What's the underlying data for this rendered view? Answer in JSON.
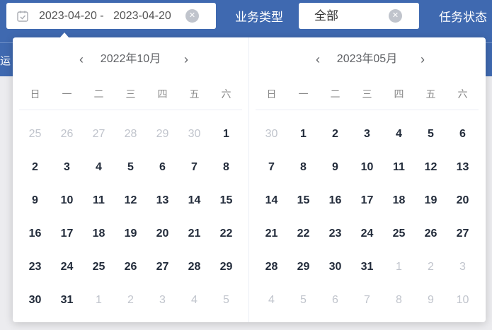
{
  "filters": {
    "date_range": "2023-04-20 -   2023-04-20",
    "business_type_label": "业务类型",
    "business_type_value": "全部",
    "task_status_label": "任务状态",
    "underlying_tab": "运"
  },
  "icons": {
    "calendar": "calendar-icon",
    "clear": "clear-icon",
    "prev": "chevron-left-icon",
    "next": "chevron-right-icon"
  },
  "colors": {
    "header": "#3f69b0",
    "muted_day": "#c0c4cc",
    "day": "#222b3a"
  },
  "weekdays": [
    "日",
    "一",
    "二",
    "三",
    "四",
    "五",
    "六"
  ],
  "calendar": {
    "left": {
      "title": "2022年10月",
      "days": [
        {
          "d": "25",
          "m": true
        },
        {
          "d": "26",
          "m": true
        },
        {
          "d": "27",
          "m": true
        },
        {
          "d": "28",
          "m": true
        },
        {
          "d": "29",
          "m": true
        },
        {
          "d": "30",
          "m": true
        },
        {
          "d": "1",
          "m": false
        },
        {
          "d": "2",
          "m": false
        },
        {
          "d": "3",
          "m": false
        },
        {
          "d": "4",
          "m": false
        },
        {
          "d": "5",
          "m": false
        },
        {
          "d": "6",
          "m": false
        },
        {
          "d": "7",
          "m": false
        },
        {
          "d": "8",
          "m": false
        },
        {
          "d": "9",
          "m": false
        },
        {
          "d": "10",
          "m": false
        },
        {
          "d": "11",
          "m": false
        },
        {
          "d": "12",
          "m": false
        },
        {
          "d": "13",
          "m": false
        },
        {
          "d": "14",
          "m": false
        },
        {
          "d": "15",
          "m": false
        },
        {
          "d": "16",
          "m": false
        },
        {
          "d": "17",
          "m": false
        },
        {
          "d": "18",
          "m": false
        },
        {
          "d": "19",
          "m": false
        },
        {
          "d": "20",
          "m": false
        },
        {
          "d": "21",
          "m": false
        },
        {
          "d": "22",
          "m": false
        },
        {
          "d": "23",
          "m": false
        },
        {
          "d": "24",
          "m": false
        },
        {
          "d": "25",
          "m": false
        },
        {
          "d": "26",
          "m": false
        },
        {
          "d": "27",
          "m": false
        },
        {
          "d": "28",
          "m": false
        },
        {
          "d": "29",
          "m": false
        },
        {
          "d": "30",
          "m": false
        },
        {
          "d": "31",
          "m": false
        },
        {
          "d": "1",
          "m": true
        },
        {
          "d": "2",
          "m": true
        },
        {
          "d": "3",
          "m": true
        },
        {
          "d": "4",
          "m": true
        },
        {
          "d": "5",
          "m": true
        }
      ]
    },
    "right": {
      "title": "2023年05月",
      "days": [
        {
          "d": "30",
          "m": true
        },
        {
          "d": "1",
          "m": false
        },
        {
          "d": "2",
          "m": false
        },
        {
          "d": "3",
          "m": false
        },
        {
          "d": "4",
          "m": false
        },
        {
          "d": "5",
          "m": false
        },
        {
          "d": "6",
          "m": false
        },
        {
          "d": "7",
          "m": false
        },
        {
          "d": "8",
          "m": false
        },
        {
          "d": "9",
          "m": false
        },
        {
          "d": "10",
          "m": false
        },
        {
          "d": "11",
          "m": false
        },
        {
          "d": "12",
          "m": false
        },
        {
          "d": "13",
          "m": false
        },
        {
          "d": "14",
          "m": false
        },
        {
          "d": "15",
          "m": false
        },
        {
          "d": "16",
          "m": false
        },
        {
          "d": "17",
          "m": false
        },
        {
          "d": "18",
          "m": false
        },
        {
          "d": "19",
          "m": false
        },
        {
          "d": "20",
          "m": false
        },
        {
          "d": "21",
          "m": false
        },
        {
          "d": "22",
          "m": false
        },
        {
          "d": "23",
          "m": false
        },
        {
          "d": "24",
          "m": false
        },
        {
          "d": "25",
          "m": false
        },
        {
          "d": "26",
          "m": false
        },
        {
          "d": "27",
          "m": false
        },
        {
          "d": "28",
          "m": false
        },
        {
          "d": "29",
          "m": false
        },
        {
          "d": "30",
          "m": false
        },
        {
          "d": "31",
          "m": false
        },
        {
          "d": "1",
          "m": true
        },
        {
          "d": "2",
          "m": true
        },
        {
          "d": "3",
          "m": true
        },
        {
          "d": "4",
          "m": true
        },
        {
          "d": "5",
          "m": true
        },
        {
          "d": "6",
          "m": true
        },
        {
          "d": "7",
          "m": true
        },
        {
          "d": "8",
          "m": true
        },
        {
          "d": "9",
          "m": true
        },
        {
          "d": "10",
          "m": true
        }
      ]
    }
  }
}
